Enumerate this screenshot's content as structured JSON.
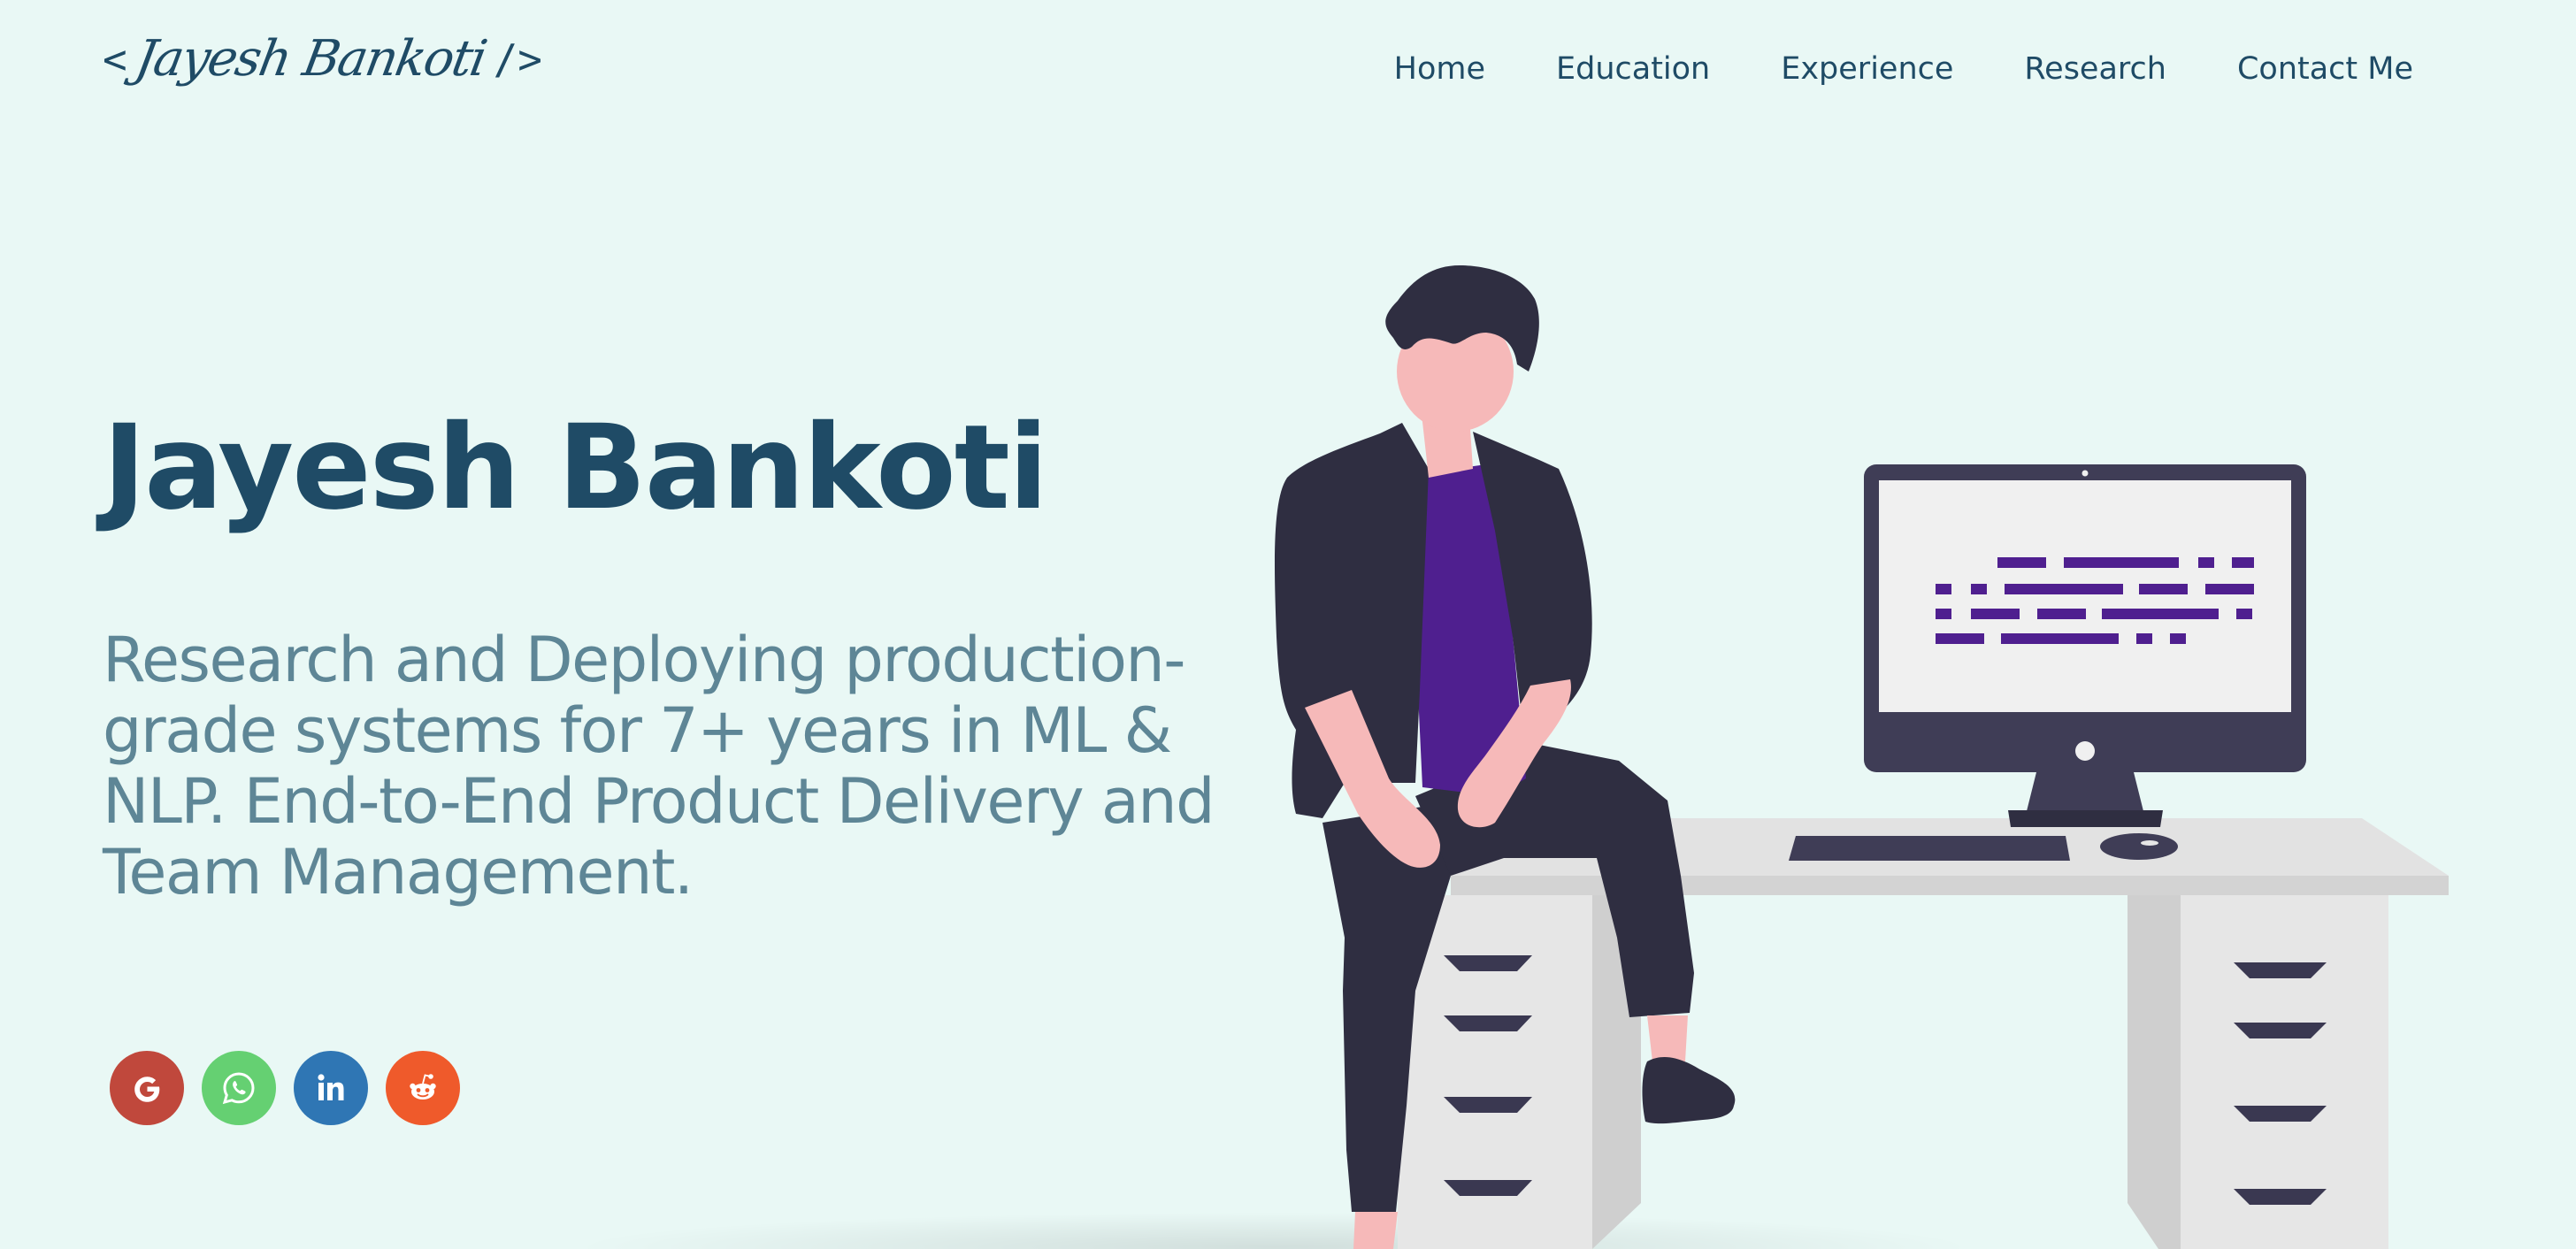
{
  "header": {
    "logo": {
      "open_bracket": "<",
      "name": "Jayesh Bankoti",
      "close_bracket": "/>"
    },
    "nav": [
      {
        "label": "Home"
      },
      {
        "label": "Education"
      },
      {
        "label": "Experience"
      },
      {
        "label": "Research"
      },
      {
        "label": "Contact Me"
      }
    ]
  },
  "hero": {
    "name": "Jayesh Bankoti",
    "tagline": "Research and Deploying production-grade systems for 7+ years in ML & NLP. End-to-End Product Delivery and Team Management.",
    "social": [
      {
        "icon": "google-icon",
        "color": "#c0483c"
      },
      {
        "icon": "whatsapp-icon",
        "color": "#65d072"
      },
      {
        "icon": "linkedin-icon",
        "color": "#2f76b4"
      },
      {
        "icon": "reddit-icon",
        "color": "#ef5a2b"
      }
    ]
  },
  "colors": {
    "background": "#e9f8f5",
    "primary_text": "#1f4b66",
    "secondary_text": "#5e8696",
    "accent_purple": "#4f1f8f",
    "dark": "#2f2e41"
  }
}
